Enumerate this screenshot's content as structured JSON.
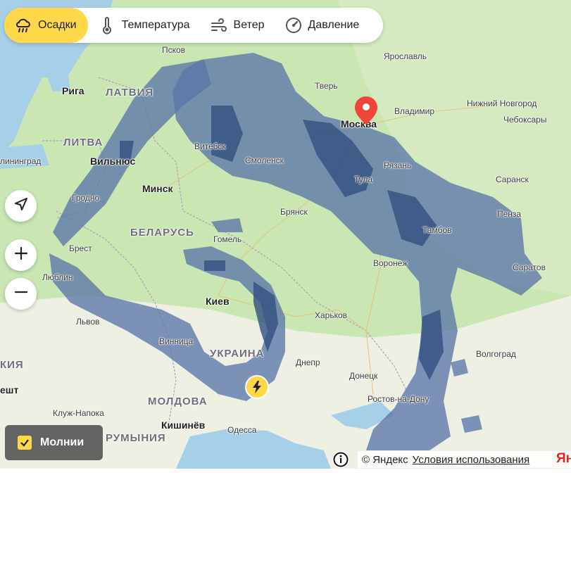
{
  "tabs": [
    {
      "label": "Осадки",
      "icon": "rain-cloud-icon",
      "active": true
    },
    {
      "label": "Температура",
      "icon": "thermometer-icon",
      "active": false
    },
    {
      "label": "Ветер",
      "icon": "wind-icon",
      "active": false
    },
    {
      "label": "Давление",
      "icon": "pressure-gauge-icon",
      "active": false
    }
  ],
  "controls": {
    "locate_icon": "locate-arrow-icon",
    "zoom_in_icon": "plus-icon",
    "zoom_out_icon": "minus-icon"
  },
  "lightning": {
    "label": "Молнии",
    "checked": true
  },
  "attribution": {
    "copyright": "© Яндекс",
    "terms": "Условия использования",
    "logo": "Ян"
  },
  "map": {
    "labels": {
      "pskov": "Псков",
      "yaroslavl": "Ярославль",
      "riga": "Рига",
      "latvia": "ЛАТВИЯ",
      "tver": "Тверь",
      "nizhny": "Нижний Новгород",
      "vladimir": "Владимир",
      "cheboksary": "Чебоксары",
      "litva": "ЛИТВА",
      "kaliningrad": "лининград",
      "vilnius": "Вильнюс",
      "vitebsk": "Витебск",
      "smolensk": "Смоленск",
      "moskva": "Москва",
      "ryazan": "Рязань",
      "saransk": "Саранск",
      "minsk": "Минск",
      "grodno": "Гродно",
      "tula": "Тула",
      "belarus": "БЕЛАРУСЬ",
      "bryansk": "Брянск",
      "penza": "Пенза",
      "tambov": "Тамбов",
      "brest": "Брест",
      "gomel": "Гомель",
      "voronezh": "Воронеж",
      "saratov": "Саратов",
      "lublin": "Люблин",
      "kiev": "Киев",
      "kharkov": "Харьков",
      "lvov": "Львов",
      "vinnitsa": "Винница",
      "ukraina": "УКРАИНА",
      "volgograd": "Волгоград",
      "dnepr": "Днепр",
      "donetsk": "Донецк",
      "kiya": "КИЯ",
      "cluj": "Клуж-Напока",
      "moldova": "МОЛДОВА",
      "rostov": "Ростов-на-Дону",
      "kishinev": "Кишинёв",
      "odessa": "Одесса",
      "romania": "РУМЫНИЯ",
      "sht": "ешт"
    }
  },
  "colors": {
    "active_tab": "#ffd84a",
    "precipitation": "#5b76a8",
    "land": "#c9e6b3",
    "water": "#a6cfe8",
    "pin": "#f0443a"
  }
}
